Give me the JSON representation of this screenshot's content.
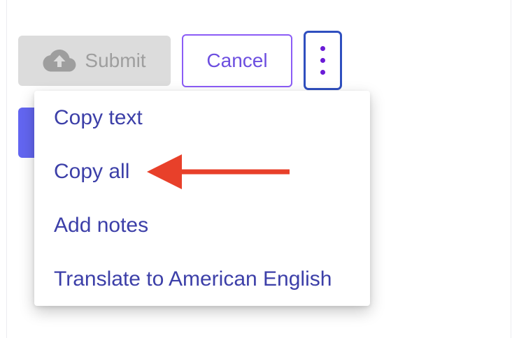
{
  "toolbar": {
    "submit_label": "Submit",
    "submit_icon": "cloud-upload-icon",
    "cancel_label": "Cancel",
    "more_icon": "vertical-ellipsis-icon"
  },
  "menu": {
    "items": [
      {
        "label": "Copy text"
      },
      {
        "label": "Copy all"
      },
      {
        "label": "Add notes"
      },
      {
        "label": "Translate to American English"
      }
    ]
  },
  "annotation": {
    "type": "arrow",
    "color": "#e8402a",
    "points_to": "Copy all"
  },
  "colors": {
    "accent": "#6366f1",
    "menu_text": "#3c3fa8",
    "cancel_border": "#8b5cf6",
    "more_border": "#2f4fbf",
    "disabled_bg": "#dcdcdc"
  }
}
